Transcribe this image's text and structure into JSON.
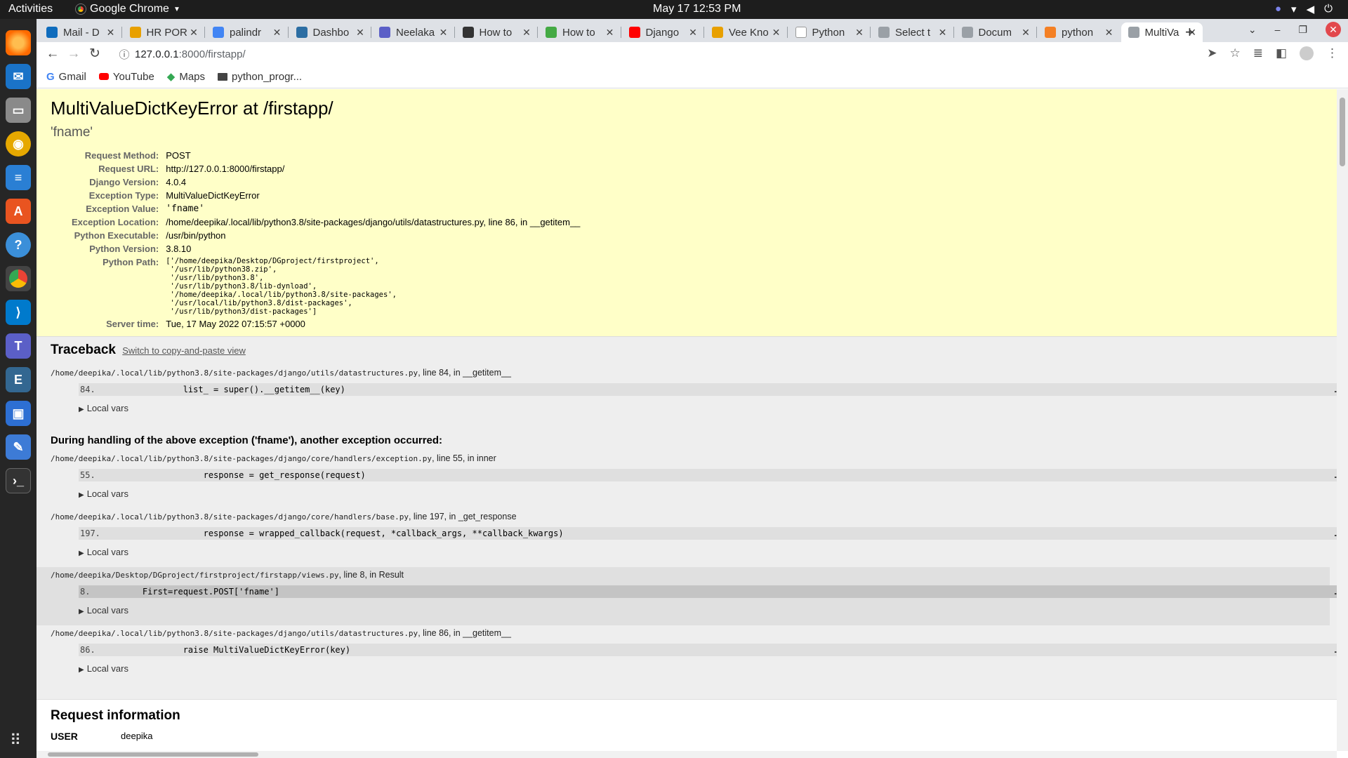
{
  "system": {
    "activities": "Activities",
    "app_name": "Google Chrome",
    "clock": "May 17  12:53 PM"
  },
  "tabs": [
    {
      "title": "Mail - D",
      "icon": "outlook-icon",
      "color": "#0f6cbd"
    },
    {
      "title": "HR POR",
      "icon": "hr-icon",
      "color": "#e8a000"
    },
    {
      "title": "palindr",
      "icon": "google-icon",
      "color": "#4285f4"
    },
    {
      "title": "Dashbo",
      "icon": "dashboard-icon",
      "color": "#2c6ea3"
    },
    {
      "title": "Neelaka",
      "icon": "teams-icon",
      "color": "#5b5fc7"
    },
    {
      "title": "How to",
      "icon": "howto-icon",
      "color": "#333333"
    },
    {
      "title": "How to",
      "icon": "howto-icon",
      "color": "#44aa44"
    },
    {
      "title": "Django",
      "icon": "youtube-icon",
      "color": "#ff0000"
    },
    {
      "title": "Vee Kno",
      "icon": "vee-icon",
      "color": "#e8a000"
    },
    {
      "title": "Python",
      "icon": "w3-icon",
      "color": "#ffffff"
    },
    {
      "title": "Select t",
      "icon": "globe-icon",
      "color": "#9aa0a6"
    },
    {
      "title": "Docum",
      "icon": "globe-icon",
      "color": "#9aa0a6"
    },
    {
      "title": "python",
      "icon": "so-icon",
      "color": "#f48024"
    },
    {
      "title": "MultiVa",
      "icon": "globe-icon",
      "color": "#9aa0a6",
      "active": true
    }
  ],
  "toolbar": {
    "url_host": "127.0.0.1",
    "url_path": ":8000/firstapp/"
  },
  "bookmarks": [
    {
      "label": "Gmail",
      "icon": "google-icon"
    },
    {
      "label": "YouTube",
      "icon": "youtube-icon"
    },
    {
      "label": "Maps",
      "icon": "maps-icon"
    },
    {
      "label": "python_progr...",
      "icon": "folder-icon"
    }
  ],
  "summary": {
    "title": "MultiValueDictKeyError at /firstapp/",
    "exception_value_title": "'fname'",
    "rows": [
      {
        "key": "Request Method:",
        "value": "POST"
      },
      {
        "key": "Request URL:",
        "value": "http://127.0.0.1:8000/firstapp/"
      },
      {
        "key": "Django Version:",
        "value": "4.0.4"
      },
      {
        "key": "Exception Type:",
        "value": "MultiValueDictKeyError"
      },
      {
        "key": "Exception Value:",
        "value": "'fname'"
      },
      {
        "key": "Exception Location:",
        "value": "/home/deepika/.local/lib/python3.8/site-packages/django/utils/datastructures.py, line 86, in __getitem__"
      },
      {
        "key": "Python Executable:",
        "value": "/usr/bin/python"
      },
      {
        "key": "Python Version:",
        "value": "3.8.10"
      },
      {
        "key": "Python Path:",
        "value": "['/home/deepika/Desktop/DGproject/firstproject',\n '/usr/lib/python38.zip',\n '/usr/lib/python3.8',\n '/usr/lib/python3.8/lib-dynload',\n '/home/deepika/.local/lib/python3.8/site-packages',\n '/usr/local/lib/python3.8/dist-packages',\n '/usr/lib/python3/dist-packages']"
      },
      {
        "key": "Server time:",
        "value": "Tue, 17 May 2022 07:15:57 +0000"
      }
    ]
  },
  "traceback": {
    "title": "Traceback",
    "switch_link": "Switch to copy-and-paste view",
    "local_vars": "Local vars",
    "during": "During handling of the above exception ('fname'), another exception occurred:",
    "frames": [
      {
        "file": "/home/deepika/.local/lib/python3.8/site-packages/django/utils/datastructures.py",
        "where": ", line 84, in __getitem__",
        "lineno": "84.",
        "code": "            list_ = super().__getitem__(key)",
        "dots": "…"
      },
      {
        "file": "/home/deepika/.local/lib/python3.8/site-packages/django/core/handlers/exception.py",
        "where": ", line 55, in inner",
        "lineno": "55.",
        "code": "                response = get_response(request)",
        "dots": "…"
      },
      {
        "file": "/home/deepika/.local/lib/python3.8/site-packages/django/core/handlers/base.py",
        "where": ", line 197, in _get_response",
        "lineno": "197.",
        "code": "                response = wrapped_callback(request, *callback_args, **callback_kwargs)",
        "dots": "…"
      },
      {
        "file": "/home/deepika/Desktop/DGproject/firstproject/firstapp/views.py",
        "where": ", line 8, in Result",
        "lineno": "8.",
        "code": "    First=request.POST['fname']",
        "dots": "…"
      },
      {
        "file": "/home/deepika/.local/lib/python3.8/site-packages/django/utils/datastructures.py",
        "where": ", line 86, in __getitem__",
        "lineno": "86.",
        "code": "            raise MultiValueDictKeyError(key)",
        "dots": "…"
      }
    ]
  },
  "request_info": {
    "title": "Request information",
    "user_key": "USER",
    "user_value": "deepika"
  }
}
